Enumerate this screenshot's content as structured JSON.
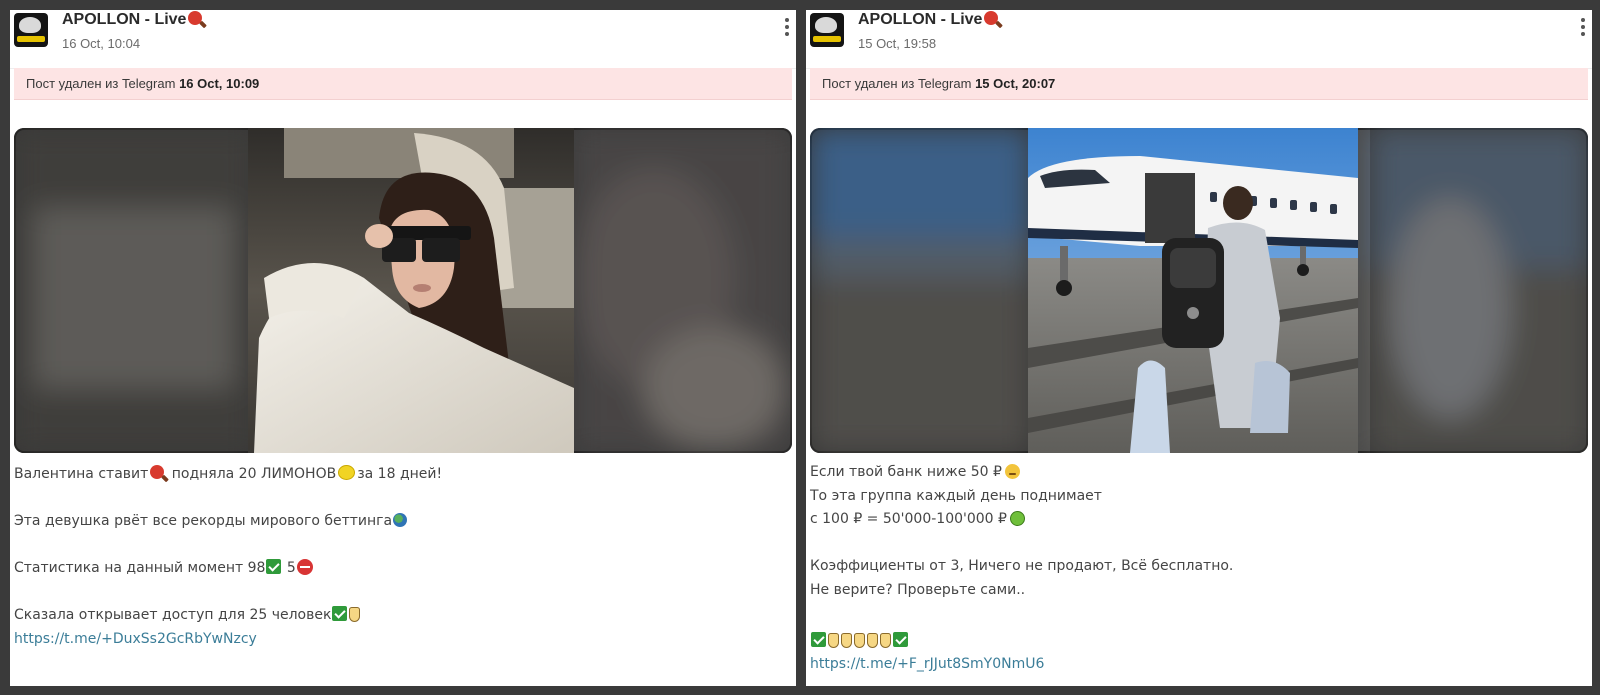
{
  "posts": [
    {
      "channel": "APOLLON - Live",
      "date": "16 Oct, 10:04",
      "deleted_prefix": "Пост удален из Telegram",
      "deleted_time": "16 Oct, 10:09",
      "text": {
        "l1a": "Валентина ставит",
        "l1b": "подняла 20 ЛИМОНОВ",
        "l1c": "за 18 дней!",
        "l2": "Эта девушка рвёт все рекорды мирового беттинга",
        "l3a": "Статистика на данный момент 98",
        "l3b": "5",
        "l4": "Сказала открывает доступ для 25 человек",
        "link": "https://t.me/+DuxSs2GcRbYwNzcy"
      },
      "image_alt": "woman in sunglasses sitting in a car"
    },
    {
      "channel": "APOLLON - Live",
      "date": "15 Oct, 19:58",
      "deleted_prefix": "Пост удален из Telegram",
      "deleted_time": "15 Oct, 20:07",
      "text": {
        "l1": "Если твой банк ниже 50 ₽",
        "l2": "То эта группа каждый день поднимает",
        "l3": "с 100 ₽ = 50'000-100'000 ₽",
        "l4": "Коэффициенты от 3, Ничего не продают, Всё бесплатно.",
        "l5": "Не верите? Проверьте сами..",
        "link": "https://t.me/+F_rJJut8SmY0NmU6"
      },
      "image_alt": "man with backpack walking to a private jet"
    }
  ],
  "colors": {
    "alert_bg": "#fde4e4",
    "link": "#3b7d98",
    "text": "#454545"
  },
  "icons": [
    "paddle-icon",
    "lemon-icon",
    "globe-icon",
    "check-icon",
    "no-entry-icon",
    "pointing-down-icon",
    "sad-face-icon",
    "money-face-icon",
    "more-vertical-icon"
  ]
}
